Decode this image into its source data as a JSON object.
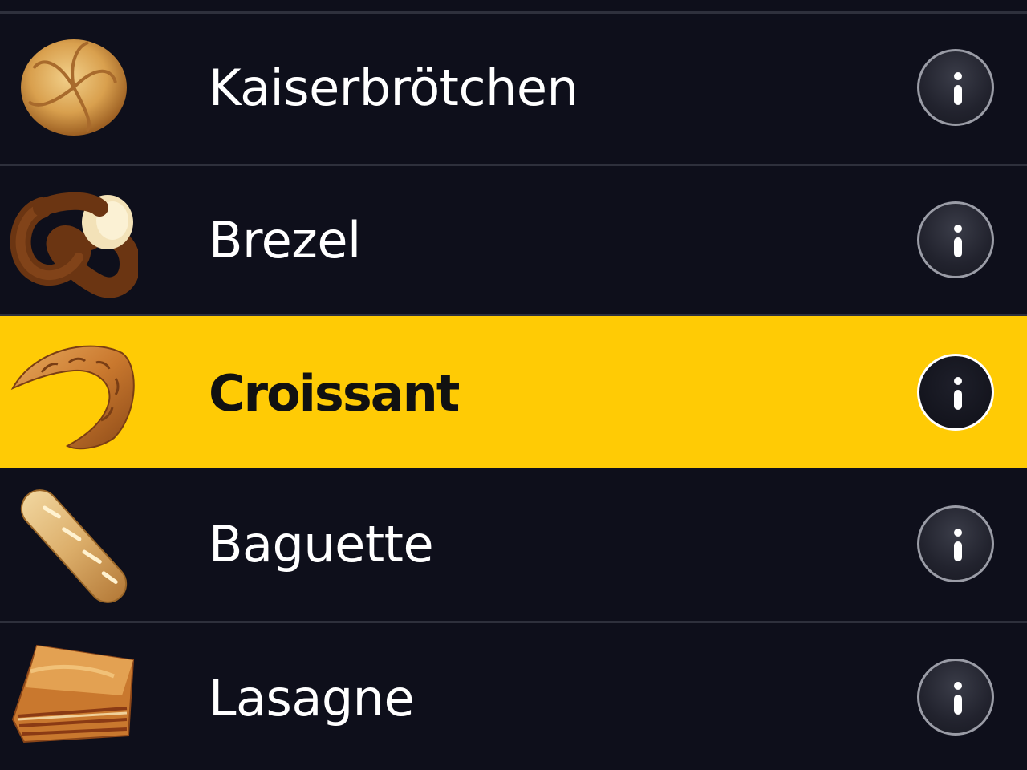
{
  "colors": {
    "background": "#0e0f1b",
    "divider": "#2e303c",
    "selected_row": "#ffcb05",
    "text": "#ffffff",
    "selected_text": "#111111"
  },
  "list": {
    "selected_index": 2,
    "items": [
      {
        "label": "Kaiserbrötchen",
        "image": "kaiser-roll",
        "info_icon": "info-icon"
      },
      {
        "label": "Brezel",
        "image": "pretzel",
        "info_icon": "info-icon"
      },
      {
        "label": "Croissant",
        "image": "croissant",
        "info_icon": "info-icon"
      },
      {
        "label": "Baguette",
        "image": "baguette",
        "info_icon": "info-icon"
      },
      {
        "label": "Lasagne",
        "image": "lasagne",
        "info_icon": "info-icon"
      }
    ]
  }
}
